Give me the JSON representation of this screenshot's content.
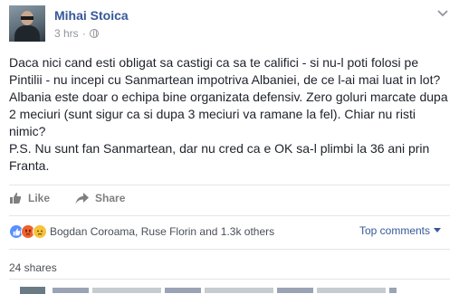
{
  "post": {
    "author": "Mihai Stoica",
    "time": "3 hrs",
    "separator": "·",
    "body": [
      "Daca nici cand esti obligat sa castigi ca sa te califici - si nu-l poti folosi pe Pintilii - nu incepi cu Sanmartean impotriva Albaniei, de ce l-ai mai luat in lot? Albania este doar o echipa bine organizata defensiv. Zero goluri marcate dupa 2 meciuri (sunt sigur ca si dupa 3 meciuri va ramane la fel). Chiar nu risti nimic?",
      "P.S. Nu sunt fan Sanmartean, dar nu cred ca e OK sa-l plimbi la 36 ani prin Franta."
    ]
  },
  "actions": {
    "like_label": "Like",
    "share_label": "Share"
  },
  "reactions": {
    "summary": "Bogdan Coroama, Ruse Florin and 1.3k others",
    "types": [
      "like",
      "angry",
      "sad"
    ],
    "colors": {
      "like": "#5890ff",
      "angry": "#f0612e",
      "sad": "#f5c33b"
    }
  },
  "comments": {
    "sort_label": "Top comments"
  },
  "shares": {
    "label": "24 shares"
  },
  "theme": {
    "link_color": "#365899",
    "muted_color": "#90949c"
  }
}
